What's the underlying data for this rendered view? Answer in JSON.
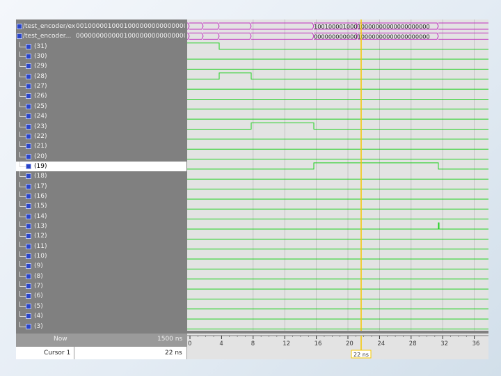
{
  "signals": [
    {
      "label": "/test_encoder/ex",
      "value": "00100000100010000000000000000000",
      "bus": true
    },
    {
      "label": "/test_encoder...",
      "value": "00000000000010000000000000000000",
      "bus": true
    },
    {
      "label": "(31)"
    },
    {
      "label": "(30)"
    },
    {
      "label": "(29)"
    },
    {
      "label": "(28)"
    },
    {
      "label": "(27)"
    },
    {
      "label": "(26)"
    },
    {
      "label": "(25)"
    },
    {
      "label": "(24)"
    },
    {
      "label": "(23)"
    },
    {
      "label": "(22)"
    },
    {
      "label": "(21)"
    },
    {
      "label": "(20)"
    },
    {
      "label": "(19)",
      "selected": true
    },
    {
      "label": "(18)"
    },
    {
      "label": "(17)"
    },
    {
      "label": "(16)"
    },
    {
      "label": "(15)"
    },
    {
      "label": "(14)"
    },
    {
      "label": "(13)"
    },
    {
      "label": "(12)"
    },
    {
      "label": "(11)"
    },
    {
      "label": "(10)"
    },
    {
      "label": "(9)"
    },
    {
      "label": "(8)"
    },
    {
      "label": "(7)"
    },
    {
      "label": "(6)"
    },
    {
      "label": "(5)"
    },
    {
      "label": "(4)"
    },
    {
      "label": "(3)"
    }
  ],
  "bus_segments": [
    {
      "text": "10010000100010000000000000000000"
    },
    {
      "text": "00000000000010000000000000000000"
    }
  ],
  "timeline": {
    "ticks": [
      "0",
      "4",
      "8",
      "12",
      "16",
      "20",
      "24",
      "28",
      "32",
      "36"
    ],
    "cursor_value": "22 ns"
  },
  "status": {
    "now_label": "Now",
    "now_value": "1500 ns",
    "cursor_label": "Cursor 1",
    "cursor_value": "22 ns"
  },
  "colors": {
    "wave": "#1fd01f",
    "bus": "#c030c0",
    "cursor": "#f5c800",
    "icon": "#2a45c8"
  }
}
